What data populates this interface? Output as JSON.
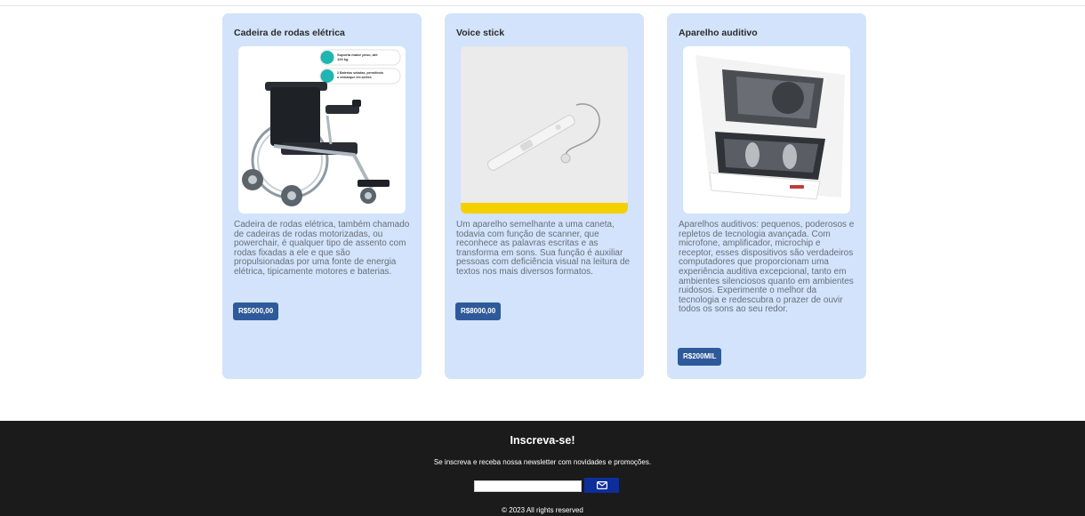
{
  "products": [
    {
      "title": "Cadeira de rodas elétrica",
      "image_badges": [
        "Suporta maior peso, até 120 kg",
        "2 Baterias seladas, permitindo o embarque em aviões"
      ],
      "description": "Cadeira de rodas elétrica, também chamado de cadeiras de rodas motorizadas, ou powerchair, é qualquer tipo de assento com rodas fixadas a ele e que são propulsionadas por uma fonte de energia elétrica, tipicamente motores e baterias.",
      "price": "R$5000,00"
    },
    {
      "title": "Voice stick",
      "description": "Um aparelho semelhante a uma caneta, todavia com função de scanner, que reconhece as palavras escritas e as transforma em sons. Sua função é auxiliar pessoas com deficiência visual na leitura de textos nos mais diversos formatos.",
      "price": "R$8000,00"
    },
    {
      "title": "Aparelho auditivo",
      "description": "Aparelhos auditivos: pequenos, poderosos e repletos de tecnologia avançada. Com microfone, amplificador, microchip e receptor, esses dispositivos são verdadeiros computadores que proporcionam uma experiência auditiva excepcional, tanto em ambientes silenciosos quanto em ambientes ruidosos. Experimente o melhor da tecnologia e redescubra o prazer de ouvir todos os sons ao seu redor.",
      "price": "R$200MIL"
    }
  ],
  "footer": {
    "title": "Inscreva-se!",
    "subtitle": "Se inscreva e receba nossa newsletter com novidades e promoções.",
    "email_value": "",
    "send_icon": "envelope-icon",
    "copyright": "© 2023 All rights reserved"
  },
  "colors": {
    "card_bg": "#d2e3fb",
    "price_button": "#2e5a9c",
    "footer_bg": "#1b1b1b",
    "send_button": "#0d2e9a",
    "voice_stick_accent": "#f5d000"
  }
}
